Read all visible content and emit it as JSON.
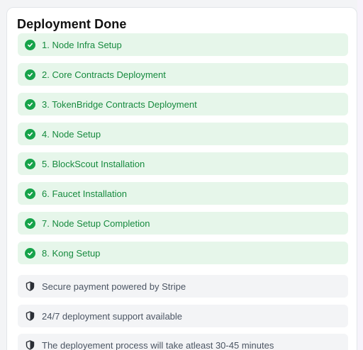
{
  "card": {
    "title": "Deployment Done",
    "steps": [
      {
        "label": "1. Node Infra Setup",
        "status": "complete"
      },
      {
        "label": "2. Core Contracts Deployment",
        "status": "complete"
      },
      {
        "label": "3. TokenBridge Contracts Deployment",
        "status": "complete"
      },
      {
        "label": "4. Node Setup",
        "status": "complete"
      },
      {
        "label": "5. BlockScout Installation",
        "status": "complete"
      },
      {
        "label": "6. Faucet Installation",
        "status": "complete"
      },
      {
        "label": "7. Node Setup Completion",
        "status": "complete"
      },
      {
        "label": "8. Kong Setup",
        "status": "complete"
      }
    ],
    "info": [
      {
        "label": "Secure payment powered by Stripe",
        "icon": "shield-icon"
      },
      {
        "label": "24/7 deployment support available",
        "icon": "shield-icon"
      },
      {
        "label": "The deployement process will take atleast 30-45 minutes",
        "icon": "shield-icon"
      }
    ]
  },
  "colors": {
    "step_background": "#e6f6ea",
    "step_text": "#168a3e",
    "check_icon": "#16a34a",
    "info_background": "#f3f4f6",
    "info_text": "#4b5563"
  }
}
